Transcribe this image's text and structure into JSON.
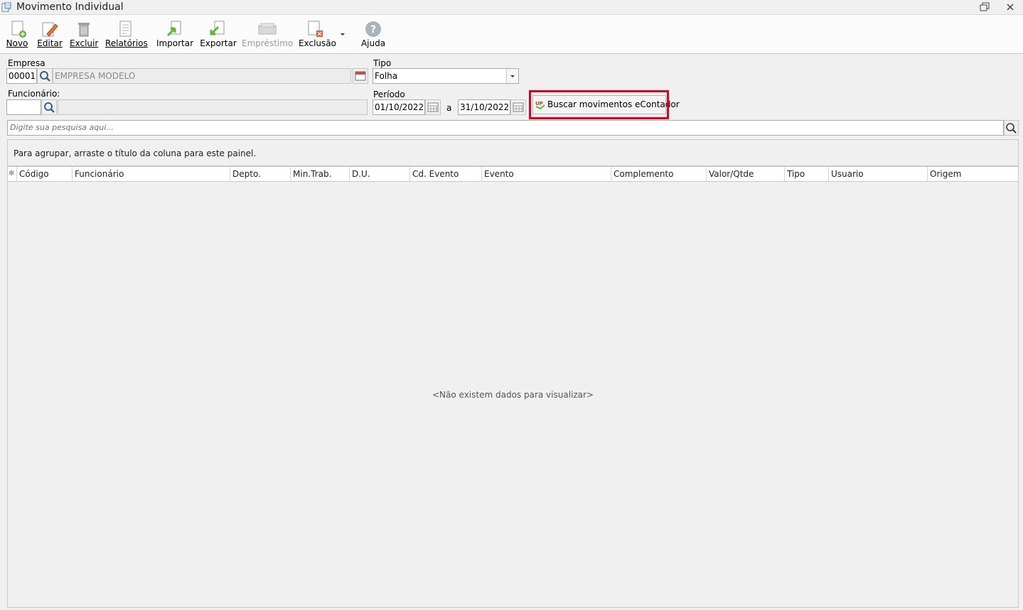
{
  "window": {
    "title": "Movimento Individual"
  },
  "toolbar": {
    "novo": "Novo",
    "editar": "Editar",
    "excluir": "Excluir",
    "relatorios": "Relatórios",
    "importar": "Importar",
    "exportar": "Exportar",
    "emprestimo": "Empréstimo",
    "exclusao": "Exclusão",
    "ajuda": "Ajuda"
  },
  "form": {
    "empresa_label": "Empresa",
    "empresa_code": "00001",
    "empresa_name": "EMPRESA MODELO",
    "tipo_label": "Tipo",
    "tipo_value": "Folha",
    "funcionario_label": "Funcionário:",
    "funcionario_code": "",
    "funcionario_name": "",
    "periodo_label": "Período",
    "periodo_inicio": "01/10/2022",
    "periodo_sep": "a",
    "periodo_fim": "31/10/2022",
    "buscar_label": "Buscar movimentos eContador",
    "search_placeholder": "Digite sua pesquisa aqui..."
  },
  "grid": {
    "group_panel_text": "Para agrupar, arraste o título da coluna para este painel.",
    "columns": [
      "Código",
      "Funcionário",
      "Depto.",
      "Min.Trab.",
      "D.U.",
      "Cd. Evento",
      "Evento",
      "Complemento",
      "Valor/Qtde",
      "Tipo",
      "Usuario",
      "Origem"
    ],
    "empty_message": "<Não existem dados para visualizar>"
  },
  "colors": {
    "highlight": "#e2001a"
  }
}
